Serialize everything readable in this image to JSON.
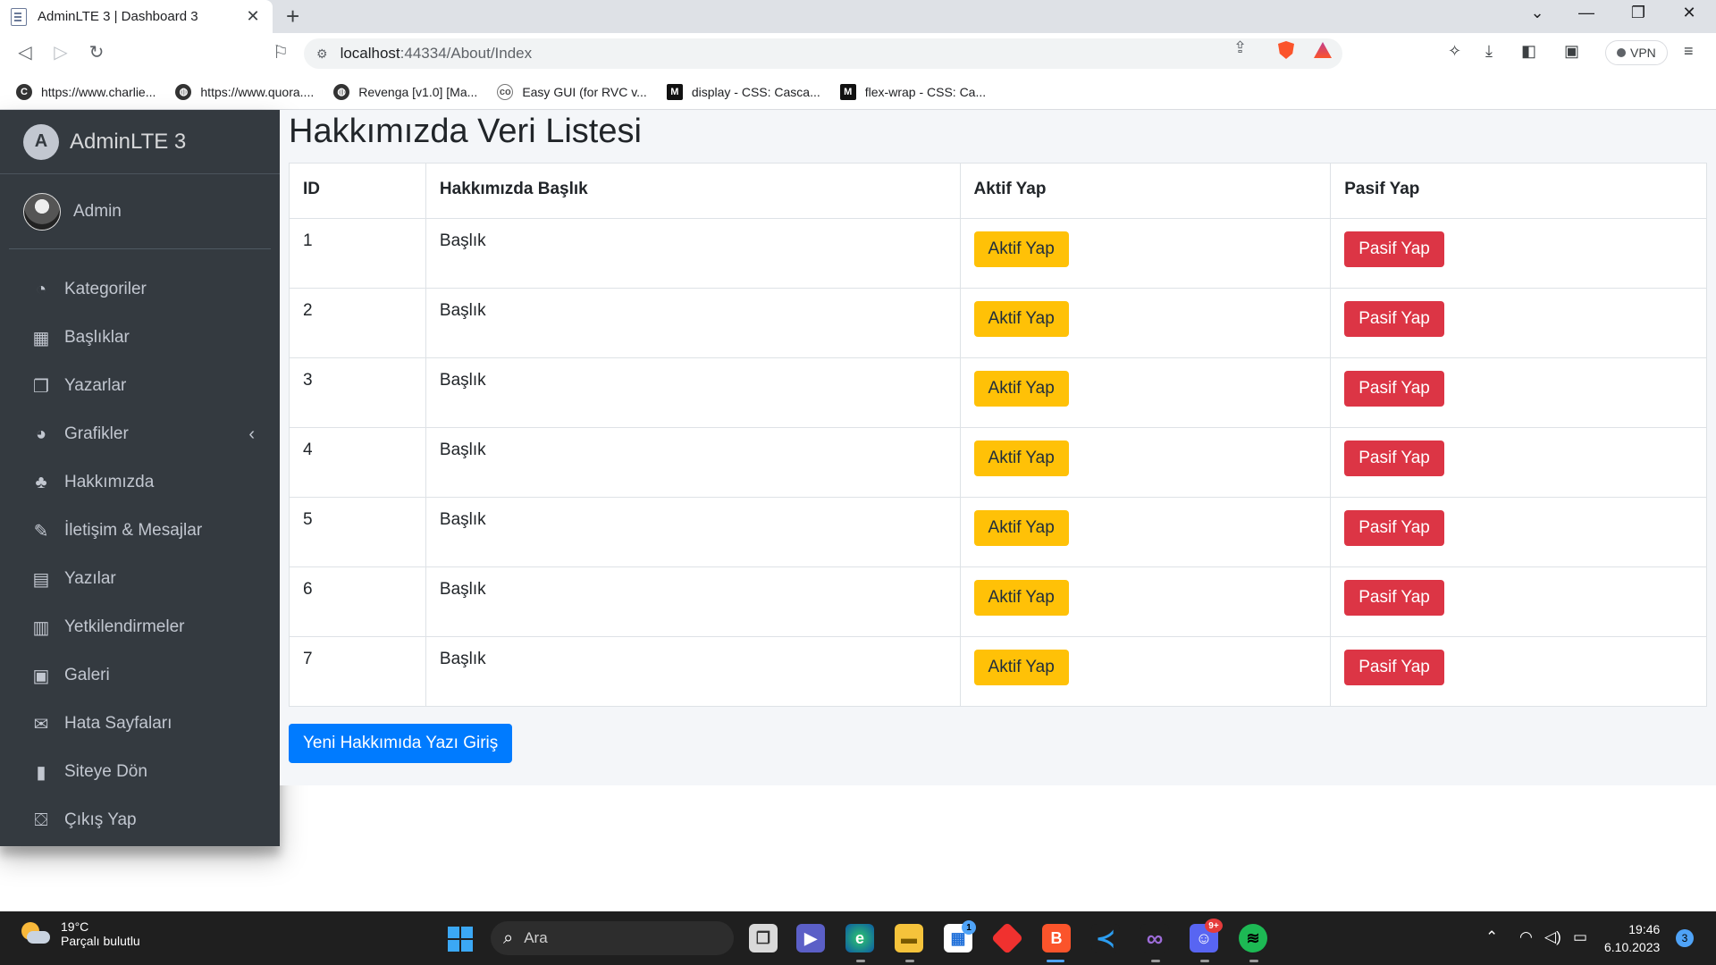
{
  "browser": {
    "tab_title": "AdminLTE 3 | Dashboard 3",
    "url_host": "localhost",
    "url_path": ":44334/About/Index",
    "vpn_label": "VPN",
    "bookmarks": [
      {
        "label": "https://www.charlie...",
        "icon": "charlie-icon"
      },
      {
        "label": "https://www.quora....",
        "icon": "globe-icon"
      },
      {
        "label": "Revenga [v1.0] [Ma...",
        "icon": "globe-icon"
      },
      {
        "label": "Easy GUI (for RVC v...",
        "icon": "co-icon"
      },
      {
        "label": "display - CSS: Casca...",
        "icon": "mdn-icon"
      },
      {
        "label": "flex-wrap - CSS: Ca...",
        "icon": "mdn-icon"
      }
    ]
  },
  "sidebar": {
    "brand": "AdminLTE 3",
    "user": "Admin",
    "items": [
      {
        "label": "Kategoriler",
        "icon": "dashboard-icon"
      },
      {
        "label": "Başlıklar",
        "icon": "grid-icon"
      },
      {
        "label": "Yazarlar",
        "icon": "copy-icon"
      },
      {
        "label": "Grafikler",
        "icon": "pie-chart-icon"
      },
      {
        "label": "Hakkımızda",
        "icon": "tree-icon"
      },
      {
        "label": "İletişim & Mesajlar",
        "icon": "edit-icon"
      },
      {
        "label": "Yazılar",
        "icon": "table-icon"
      },
      {
        "label": "Yetkilendirmeler",
        "icon": "calendar-icon"
      },
      {
        "label": "Galeri",
        "icon": "image-icon"
      },
      {
        "label": "Hata Sayfaları",
        "icon": "envelope-icon"
      },
      {
        "label": "Siteye Dön",
        "icon": "book-icon"
      },
      {
        "label": "Çıkış Yap",
        "icon": "user-door-icon"
      }
    ]
  },
  "main": {
    "title": "Hakkımızda Veri Listesi",
    "columns": [
      "ID",
      "Hakkımızda Başlık",
      "Aktif Yap",
      "Pasif Yap"
    ],
    "rows": [
      {
        "id": "1",
        "title": "Başlık",
        "activate": "Aktif Yap",
        "deactivate": "Pasif Yap"
      },
      {
        "id": "2",
        "title": "Başlık",
        "activate": "Aktif Yap",
        "deactivate": "Pasif Yap"
      },
      {
        "id": "3",
        "title": "Başlık",
        "activate": "Aktif Yap",
        "deactivate": "Pasif Yap"
      },
      {
        "id": "4",
        "title": "Başlık",
        "activate": "Aktif Yap",
        "deactivate": "Pasif Yap"
      },
      {
        "id": "5",
        "title": "Başlık",
        "activate": "Aktif Yap",
        "deactivate": "Pasif Yap"
      },
      {
        "id": "6",
        "title": "Başlık",
        "activate": "Aktif Yap",
        "deactivate": "Pasif Yap"
      },
      {
        "id": "7",
        "title": "Başlık",
        "activate": "Aktif Yap",
        "deactivate": "Pasif Yap"
      }
    ],
    "add_button": "Yeni Hakkımıda Yazı Giriş"
  },
  "taskbar": {
    "temperature": "19°C",
    "weather": "Parçalı bulutlu",
    "search_placeholder": "Ara",
    "time": "19:46",
    "date": "6.10.2023",
    "notification_count": "3",
    "store_badge": "1",
    "discord_badge": "9+"
  },
  "colors": {
    "sidebar_bg": "#343a40",
    "content_bg": "#f4f6f9",
    "warning": "#ffc107",
    "danger": "#dc3545",
    "primary": "#007bff"
  }
}
